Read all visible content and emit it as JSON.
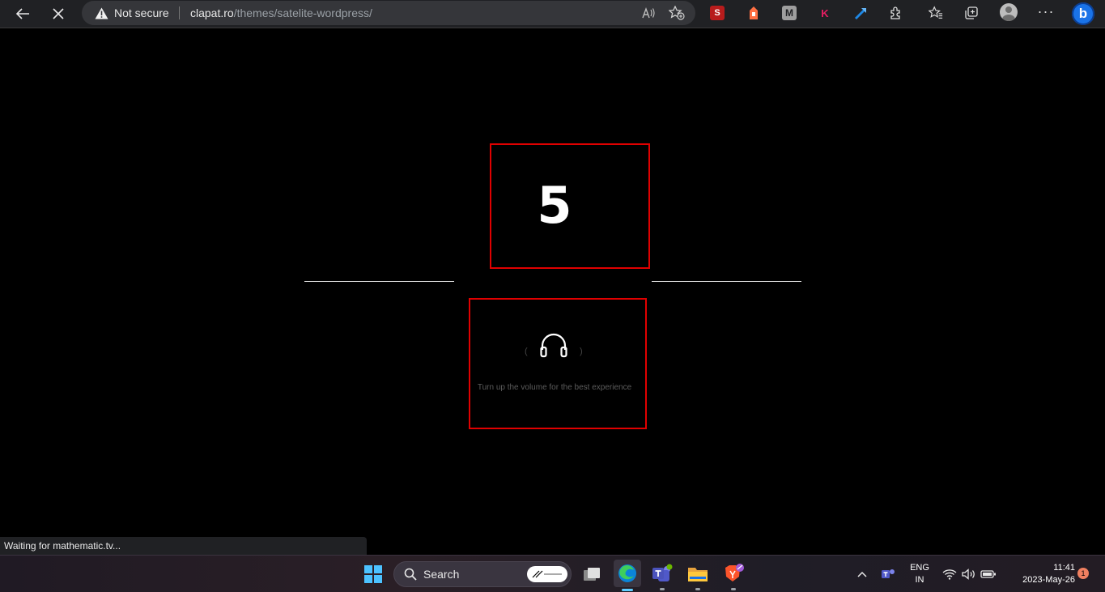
{
  "browser": {
    "security_label": "Not secure",
    "url_host": "clapat.ro",
    "url_path": "/themes/satelite-wordpress/",
    "extensions": [
      {
        "name": "seo-extension",
        "label": "S",
        "color": "#e53935"
      },
      {
        "name": "orange-extension",
        "label": "",
        "color": "#ff7043"
      },
      {
        "name": "m-extension",
        "label": "M",
        "color": "#9e9e9e"
      },
      {
        "name": "k-extension",
        "label": "K",
        "color": "#e91e63"
      },
      {
        "name": "blue-extension",
        "label": "",
        "color": "#1e88e5"
      }
    ],
    "menu_label": "···",
    "bing_label": "b"
  },
  "preloader": {
    "countdown_value": "5",
    "volume_hint": "Turn up the volume for the best experience",
    "accent_color": "#e00000"
  },
  "status_bar": {
    "text": "Waiting for mathematic.tv..."
  },
  "taskbar": {
    "search_label": "Search",
    "language": "ENG",
    "region": "IN",
    "time": "11:41",
    "date": "2023-May-26",
    "notification_count": "1"
  }
}
